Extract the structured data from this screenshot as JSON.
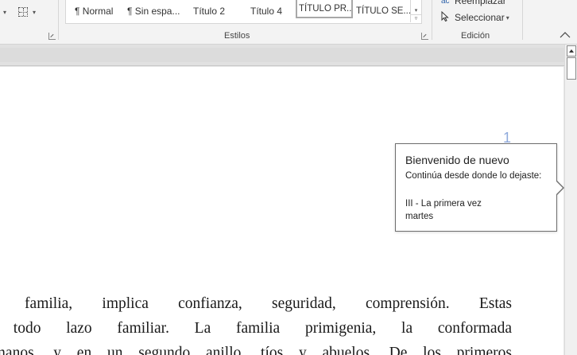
{
  "ribbon": {
    "styles": [
      {
        "label": "¶ Normal"
      },
      {
        "label": "¶ Sin espa..."
      },
      {
        "label": "Título 2"
      },
      {
        "label": "Título 4"
      },
      {
        "label": "TÍTULO PR...",
        "selected": true
      },
      {
        "label": "TÍTULO SE..."
      }
    ],
    "styles_group_label": "Estilos",
    "editing": {
      "replace_label": "Reemplazar",
      "replace_icon": "ac",
      "select_label": "Seleccionar",
      "group_label": "Edición"
    }
  },
  "document": {
    "page_number": "1",
    "body_lines": [
      "de una familia, implica confianza, seguridad, comprensión. Estas",
      "ran en todo lazo familiar. La familia primigenia, la conformada",
      "s y hermanos, y en un segundo anillo, tíos y abuelos. De los primeros"
    ]
  },
  "welcome": {
    "title": "Bienvenido de nuevo",
    "subtitle": "Continúa desde donde lo dejaste:",
    "location": "III - La primera vez",
    "day": "martes"
  },
  "icons": {
    "paragraph": "pilcrow-icon",
    "borders": "borders-icon",
    "find_replace": "replace-icon",
    "select": "cursor-arrow-icon",
    "collapse": "chevron-up-icon"
  },
  "colors": {
    "ribbon_bg": "#f3f3f3",
    "page_number": "#8faadc",
    "callout_border": "#6e6e6e"
  }
}
